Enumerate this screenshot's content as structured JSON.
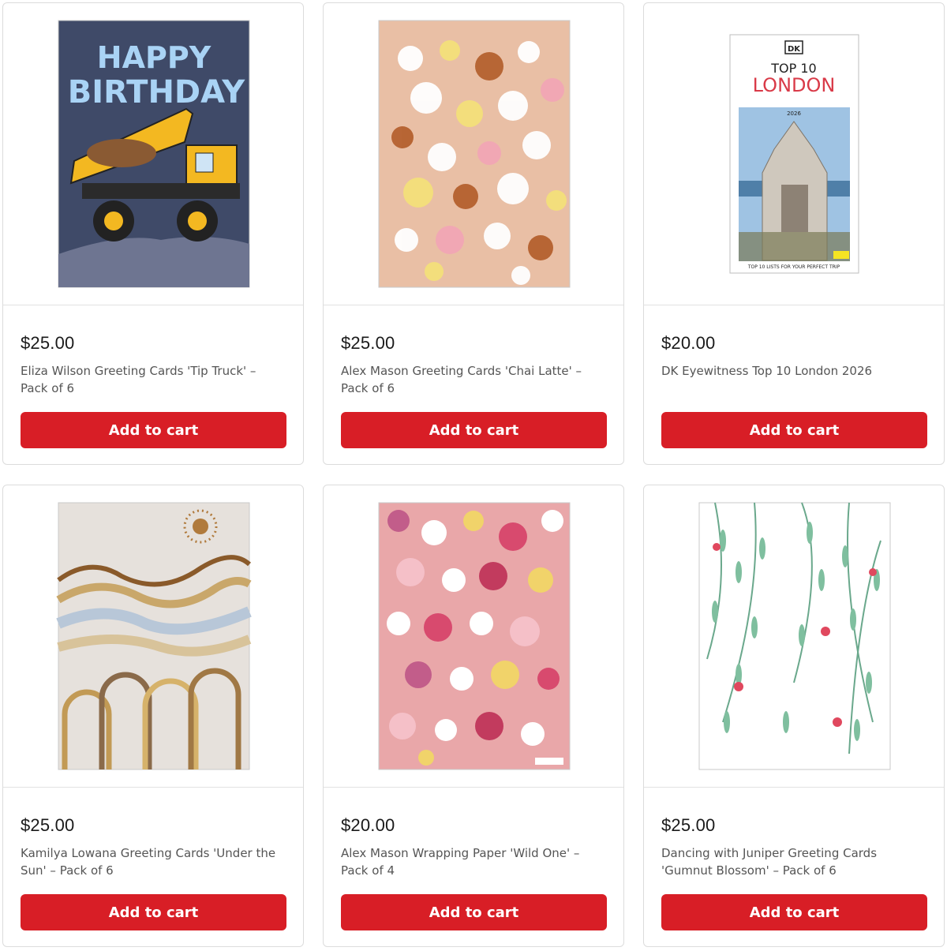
{
  "products": [
    {
      "price": "$25.00",
      "title": "Eliza Wilson Greeting Cards 'Tip Truck' – Pack of 6",
      "button": "Add to cart",
      "image_icon": "birthday-truck-card",
      "image_text": [
        "HAPPY",
        "BIRTHDAY"
      ]
    },
    {
      "price": "$25.00",
      "title": "Alex Mason Greeting Cards 'Chai Latte' – Pack of 6",
      "button": "Add to cart",
      "image_icon": "floral-card"
    },
    {
      "price": "$20.00",
      "title": "DK Eyewitness Top 10 London 2026",
      "button": "Add to cart",
      "image_icon": "book-cover",
      "image_text": [
        "DK",
        "TOP 10",
        "LONDON",
        "2026",
        "TOP 10 LISTS FOR YOUR PERFECT TRIP"
      ]
    },
    {
      "price": "$25.00",
      "title": "Kamilya Lowana Greeting Cards 'Under the Sun' – Pack of 6",
      "button": "Add to cart",
      "image_icon": "aboriginal-art-card"
    },
    {
      "price": "$20.00",
      "title": "Alex Mason Wrapping Paper 'Wild One' – Pack of 4",
      "button": "Add to cart",
      "image_icon": "wildflower-wrapping-paper"
    },
    {
      "price": "$25.00",
      "title": "Dancing with Juniper Greeting Cards 'Gumnut Blossom' – Pack of 6",
      "button": "Add to cart",
      "image_icon": "gumnut-leaves-card"
    }
  ],
  "colors": {
    "button": "#d81e26",
    "border": "#dcdcdc"
  }
}
